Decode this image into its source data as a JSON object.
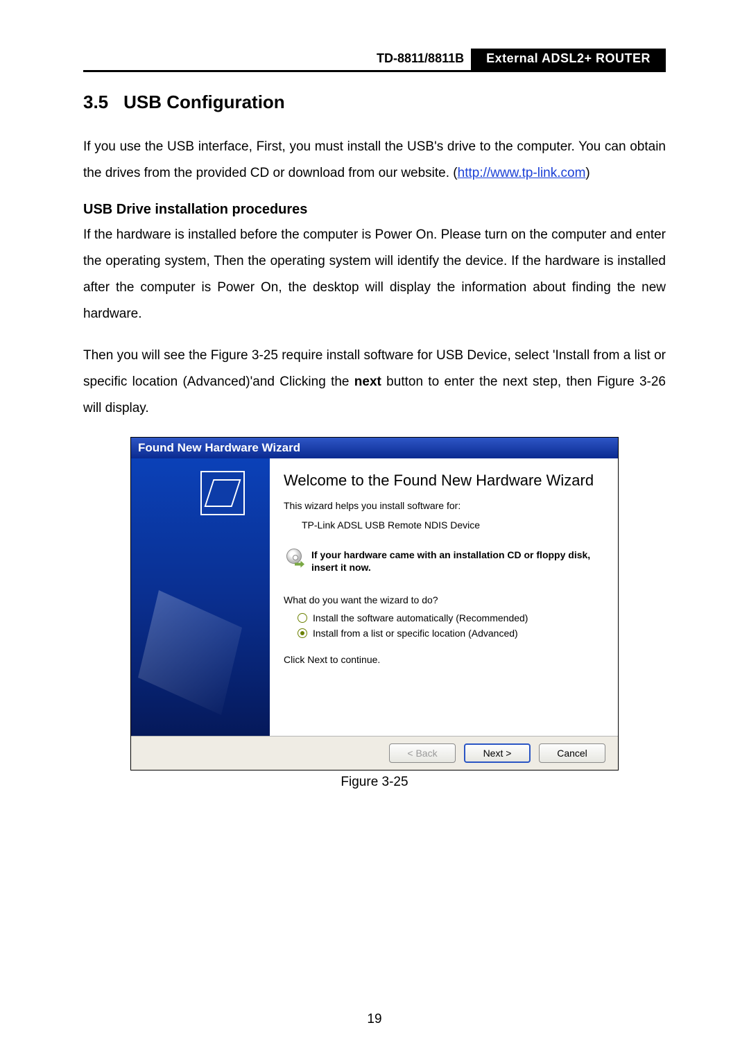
{
  "header": {
    "model": "TD-8811/8811B",
    "tag": "External  ADSL2+  ROUTER"
  },
  "section": {
    "number": "3.5",
    "title": "USB Configuration"
  },
  "para1_a": "If you use the USB interface, First, you must install the USB's drive to the computer. You can obtain the drives from the provided CD or download from our website. (",
  "link_text": "http://www.tp-link.com",
  "para1_b": ")",
  "sub_heading": "USB Drive installation procedures",
  "para2": "If the hardware is installed before the computer is Power On. Please turn on the computer and enter the operating system, Then the operating system will identify the device. If the hardware is installed after the computer is Power On, the desktop will display the information about finding the new hardware.",
  "para3_a": "Then you will see the Figure 3-25 require install software for USB Device, select 'Install from a list or specific location (Advanced)'and Clicking the ",
  "para3_bold": "next",
  "para3_b": " button to enter the next step, then Figure 3-26 will display.",
  "wizard": {
    "title": "Found New Hardware Wizard",
    "heading": "Welcome to the Found New Hardware Wizard",
    "helps": "This wizard helps you install software for:",
    "device": "TP-Link ADSL USB Remote NDIS Device",
    "insert_cd": "If your hardware came with an installation CD or floppy disk, insert it now.",
    "question": "What do you want the wizard to do?",
    "opt_auto": "Install the software automatically (Recommended)",
    "opt_list": "Install from a list or specific location (Advanced)",
    "continue": "Click Next to continue.",
    "btn_back": "< Back",
    "btn_next": "Next >",
    "btn_cancel": "Cancel"
  },
  "figure_caption": "Figure 3-25",
  "page_number": "19"
}
